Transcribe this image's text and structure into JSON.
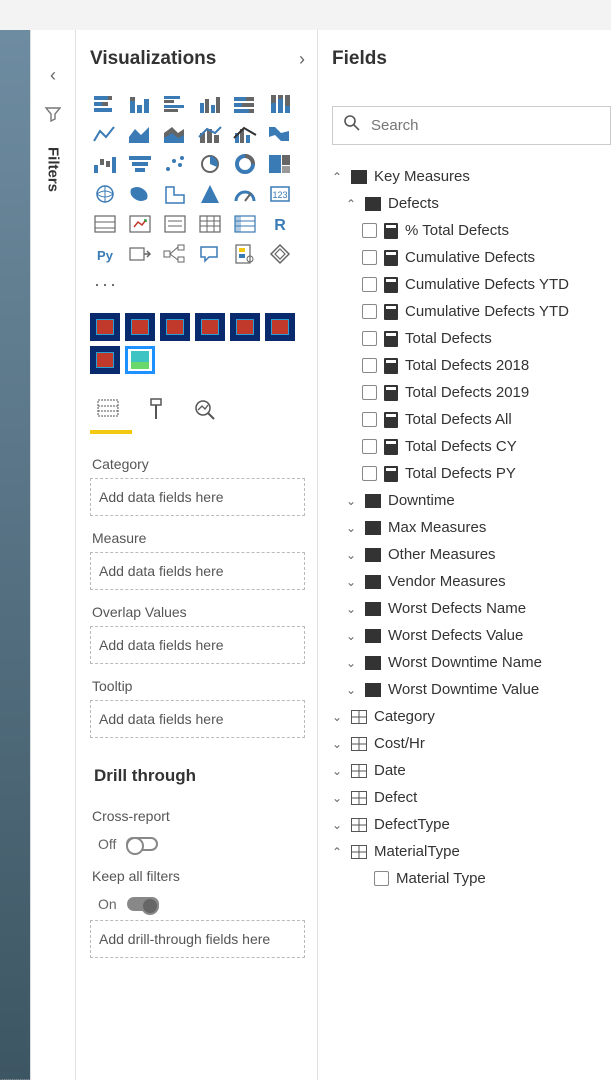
{
  "filters": {
    "label": "Filters"
  },
  "viz": {
    "title": "Visualizations",
    "more": "···",
    "tabs": {
      "fields": "fields",
      "format": "format",
      "analytics": "analytics"
    },
    "wells": {
      "category_label": "Category",
      "category_placeholder": "Add data fields here",
      "measure_label": "Measure",
      "measure_placeholder": "Add data fields here",
      "overlap_label": "Overlap Values",
      "overlap_placeholder": "Add data fields here",
      "tooltip_label": "Tooltip",
      "tooltip_placeholder": "Add data fields here"
    },
    "drill": {
      "title": "Drill through",
      "cross_report_label": "Cross-report",
      "cross_report_state": "Off",
      "keep_filters_label": "Keep all filters",
      "keep_filters_state": "On",
      "well_placeholder": "Add drill-through fields here"
    }
  },
  "fields": {
    "title": "Fields",
    "search_placeholder": "Search",
    "tree": {
      "key_measures": "Key Measures",
      "defects": "Defects",
      "defect_items": [
        "% Total Defects",
        "Cumulative Defects",
        "Cumulative Defects YTD",
        "Cumulative Defects YTD",
        "Total Defects",
        "Total Defects 2018",
        "Total Defects 2019",
        "Total Defects All",
        "Total Defects CY",
        "Total Defects PY"
      ],
      "folders": [
        "Downtime",
        "Max Measures",
        "Other Measures",
        "Vendor Measures",
        "Worst Defects Name",
        "Worst Defects Value",
        "Worst Downtime Name",
        "Worst Downtime Value"
      ],
      "tables": [
        "Category",
        "Cost/Hr",
        "Date",
        "Defect",
        "DefectType",
        "MaterialType"
      ],
      "last_item": "Material Type"
    }
  }
}
